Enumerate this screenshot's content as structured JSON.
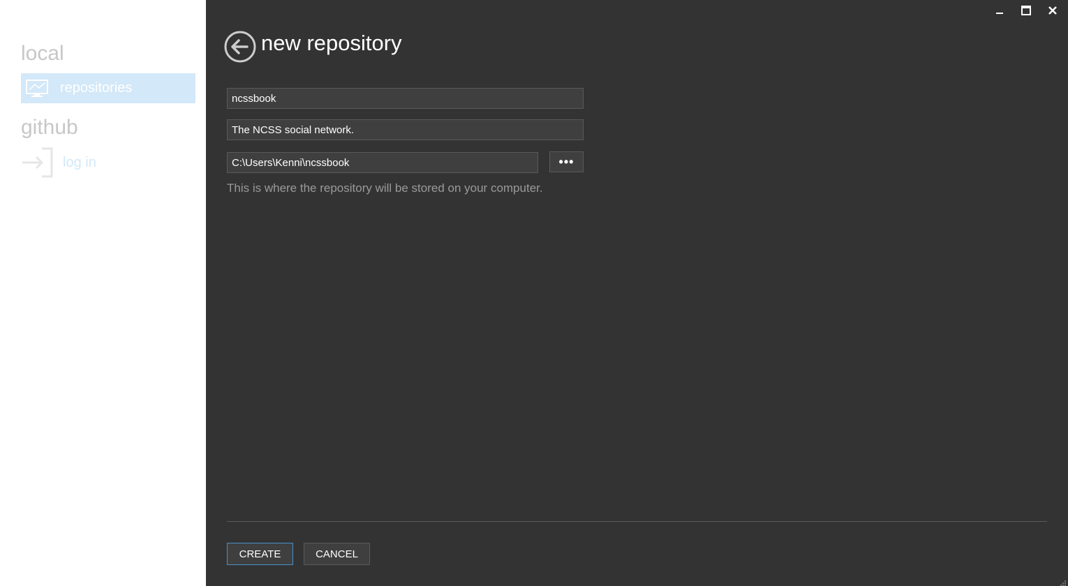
{
  "sidebar": {
    "local_title": "local",
    "repositories_label": "repositories",
    "github_title": "github",
    "login_label": "log in"
  },
  "header": {
    "title": "new repository"
  },
  "form": {
    "name_value": "ncssbook",
    "description_value": "The NCSS social network.",
    "path_value": "C:\\Users\\Kenni\\ncssbook",
    "browse_label": "•••",
    "path_hint": "This is where the repository will be stored on your computer."
  },
  "actions": {
    "create_label": "CREATE",
    "cancel_label": "CANCEL"
  },
  "icons": {
    "minimize": "minimize-icon",
    "maximize": "maximize-icon",
    "close": "close-icon",
    "back": "back-arrow-icon",
    "monitor": "monitor-icon",
    "login": "login-icon"
  },
  "colors": {
    "sidebar_bg": "#ffffff",
    "main_bg": "#333333",
    "selected_nav": "#d3e8f8",
    "accent_border": "#4a90c8"
  }
}
